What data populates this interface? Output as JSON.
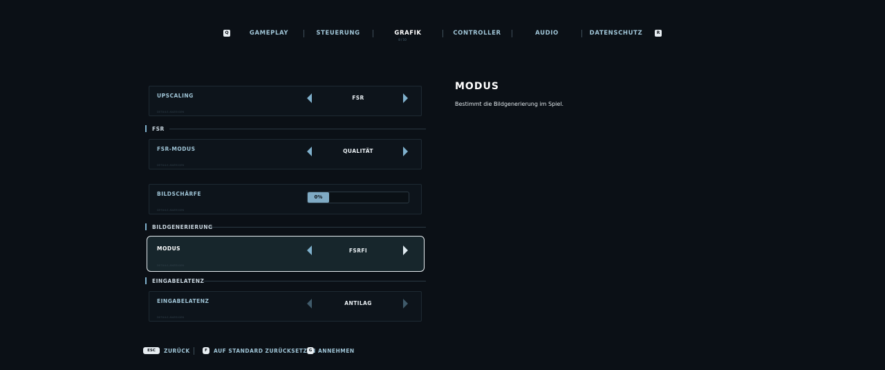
{
  "nav": {
    "key_left": "Q",
    "key_right": "R",
    "tabs": [
      {
        "label": "GAMEPLAY"
      },
      {
        "label": "STEUERUNG"
      },
      {
        "label": "GRAFIK",
        "sub": "8 / 10"
      },
      {
        "label": "CONTROLLER"
      },
      {
        "label": "AUDIO"
      },
      {
        "label": "DATENSCHUTZ"
      }
    ],
    "active_tab": "GRAFIK"
  },
  "settings": {
    "upscaling": {
      "label": "UPSCALING",
      "value": "FSR",
      "hint": "DETAILS ANZEIGEN"
    },
    "fsr_section": "FSR",
    "fsr_modus": {
      "label": "FSR-MODUS",
      "value": "QUALITÄT",
      "hint": "DETAILS ANZEIGEN"
    },
    "bildschaerfe": {
      "label": "BILDSCHÄRFE",
      "value_text": "0%",
      "value": 0,
      "hint": "DETAILS ANZEIGEN"
    },
    "bildgen_section": "BILDGENERIERUNG",
    "modus": {
      "label": "MODUS",
      "value": "FSRFI",
      "hint": "DETAILS ANZEIGEN"
    },
    "latenz_section": "EINGABELATENZ",
    "eingabelatenz": {
      "label": "EINGABELATENZ",
      "value": "ANTILAG",
      "hint": "DETAILS ANZEIGEN"
    }
  },
  "description": {
    "title": "MODUS",
    "text": "Bestimmt die Bildgenerierung im Spiel."
  },
  "footer": {
    "back_key": "ESC",
    "back_label": "ZURÜCK",
    "reset_key": "F",
    "reset_label": "AUF STANDARD ZURÜCKSETZEN",
    "accept_key": "G",
    "accept_label": "ANNEHMEN"
  },
  "colors": {
    "background": "#0b1016",
    "accent": "#7fb0cc",
    "focus_border": "#e8eef2"
  }
}
